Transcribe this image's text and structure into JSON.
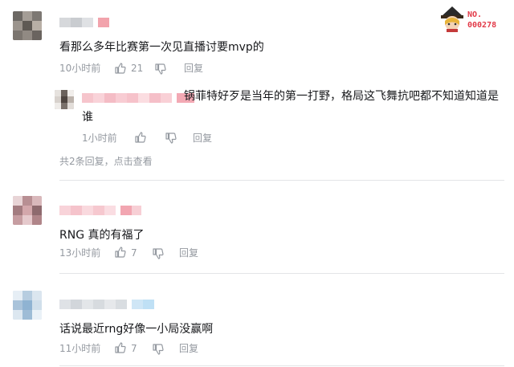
{
  "comments": [
    {
      "text": "看那么多年比赛第一次见直播讨要mvp的",
      "time": "10小时前",
      "likes": "21",
      "reply_label": "回复",
      "replies": [
        {
          "text_line1": "锅菲特好歹是当年的第一打野，格局这飞舞抗吧都不知道知道是",
          "text_line2": "谁",
          "time": "1小时前",
          "reply_label": "回复"
        }
      ],
      "reply_summary": "共2条回复，点击查看"
    },
    {
      "text": "RNG 真的有福了",
      "time": "13小时前",
      "likes": "7",
      "reply_label": "回复"
    },
    {
      "text": "话说最近rng好像一小局没赢啊",
      "time": "11小时前",
      "likes": "7",
      "reply_label": "回复"
    }
  ],
  "badge": {
    "prefix": "NO.",
    "number": "000278"
  },
  "colors": {
    "text": "#18191c",
    "meta": "#9499a0",
    "badge_red": "#e23a48",
    "divider": "#e3e5e7"
  },
  "icons": {
    "like": "thumb-up-icon",
    "dislike": "thumb-down-icon"
  }
}
